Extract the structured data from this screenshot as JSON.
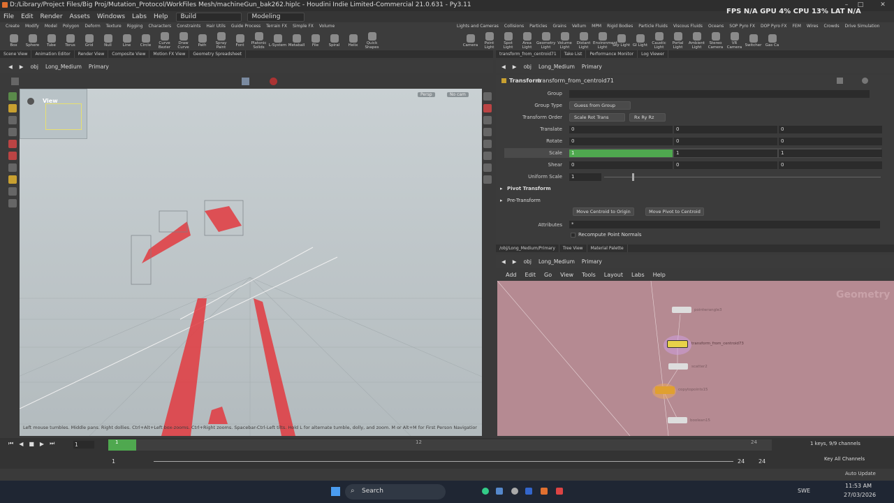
{
  "title_bar": {
    "title": "D:/Library/Project Files/Big Proj/Mutation_Protocol/WorkFiles Mesh/machineGun_bak262.hiplc - Houdini Indie Limited-Commercial 21.0.631 - Py3.11",
    "stats": "FPS N/A   GPU 4%   CPU 13%   LAT N/A"
  },
  "menus": [
    "File",
    "Edit",
    "Render",
    "Assets",
    "Windows",
    "Labs",
    "Help"
  ],
  "desktop_build": "Build",
  "desktop_modeling": "Modeling",
  "shelf_tabs_left": [
    "Create",
    "Modify",
    "Model",
    "Polygon",
    "Deform",
    "Texture",
    "Rigging",
    "Characters",
    "Constraints",
    "Hair Utils",
    "Guide Process",
    "Terrain FX",
    "Simple FX",
    "Volume"
  ],
  "shelf_tabs_right": [
    "Lights and Cameras",
    "Collisions",
    "Particles",
    "Grains",
    "Vellum",
    "MPM",
    "Rigid Bodies",
    "Particle Fluids",
    "Viscous Fluids",
    "Oceans",
    "SOP Pyro FX",
    "DOP Pyro FX",
    "FEM",
    "Wires",
    "Crowds",
    "Drive Simulation"
  ],
  "shelf_tools_left": [
    "Box",
    "Sphere",
    "Tube",
    "Torus",
    "Grid",
    "Null",
    "Line",
    "Circle",
    "Curve Bezier",
    "Draw Curve",
    "Path",
    "Spray Paint",
    "Font",
    "Platonic Solids",
    "L-System",
    "Metaball",
    "File",
    "Spiral",
    "Helix",
    "Quick Shapes"
  ],
  "shelf_tools_right": [
    "Camera",
    "Point Light",
    "Spot Light",
    "Area Light",
    "Geometry Light",
    "Volume Light",
    "Distant Light",
    "Environment Light",
    "Sky Light",
    "GI Light",
    "Caustic Light",
    "Portal Light",
    "Ambient Light",
    "Stereo Camera",
    "VR Camera",
    "Switcher",
    "Gas Ca"
  ],
  "left_pane_tabs": [
    "Scene View",
    "Animation Editor",
    "Render View",
    "Composite View",
    "Motion FX View",
    "Geometry Spreadsheet"
  ],
  "right_pane_tabs": [
    "transform_from_centroid71",
    "Take List",
    "Performance Monitor",
    "Log Viewer"
  ],
  "path": {
    "obj": "obj",
    "geo": "Long_Medium",
    "node": "Primary"
  },
  "viewport": {
    "label": "View",
    "persp": "Persp",
    "cam": "No cam",
    "hint": "Left mouse tumbles. Middle pans. Right dollies. Ctrl+Alt+Left box-zooms. Ctrl+Right zooms. Spacebar-Ctrl-Left tilts. Hold L for alternate tumble, dolly, and zoom. M or Alt+M for First Person Navigation."
  },
  "params": {
    "node_type": "Transform",
    "node_name": "transform_from_centroid71",
    "group_label": "Group",
    "group_type_label": "Group Type",
    "group_type_value": "Guess from Group",
    "order_label": "Transform Order",
    "order_value": "Scale Rot Trans",
    "rot_order_value": "Rx Ry Rz",
    "translate_label": "Translate",
    "translate": [
      "0",
      "0",
      "0"
    ],
    "rotate_label": "Rotate",
    "rotate": [
      "0",
      "0",
      "0"
    ],
    "scale_label": "Scale",
    "scale": [
      "1",
      "1",
      "1"
    ],
    "shear_label": "Shear",
    "shear": [
      "0",
      "0",
      "0"
    ],
    "uniform_label": "Uniform Scale",
    "uniform": "1",
    "uniform_fraction": 0.1,
    "pivot_label": "Pivot Transform",
    "pre_label": "Pre-Transform",
    "btn_centroid": "Move Centroid to Origin",
    "btn_pivot": "Move Pivot to Centroid",
    "attributes_label": "Attributes",
    "attributes_value": "*",
    "recompute_label": "Recompute Point Normals"
  },
  "network_tabs": [
    "/obj/Long_Medium/Primary",
    "Tree View",
    "Material Palette"
  ],
  "network_menus": [
    "Add",
    "Edit",
    "Go",
    "View",
    "Tools",
    "Layout",
    "Labs",
    "Help"
  ],
  "network": {
    "watermark": "Geometry",
    "nodes": [
      {
        "name": "pointwrangle3"
      },
      {
        "name": "transform_from_centroid73"
      },
      {
        "name": "scatter2"
      },
      {
        "name": "copytopoints15"
      },
      {
        "name": "boolean15"
      }
    ]
  },
  "timeline": {
    "frame": "1",
    "start": "1",
    "start2": "1",
    "end": "24",
    "end2": "24",
    "ticks": [
      "1",
      "12",
      "24"
    ],
    "keys": "1 keys, 9/9 channels",
    "key_all": "Key All Channels",
    "auto_update": "Auto Update"
  },
  "taskbar": {
    "search": "Search",
    "lang": "SWE",
    "time": "11:53 AM",
    "date": "27/03/2026"
  },
  "colors": {
    "accent_green": "#4fa84f",
    "geometry_red": "#e23a3f",
    "network_bg": "#b58a92"
  }
}
